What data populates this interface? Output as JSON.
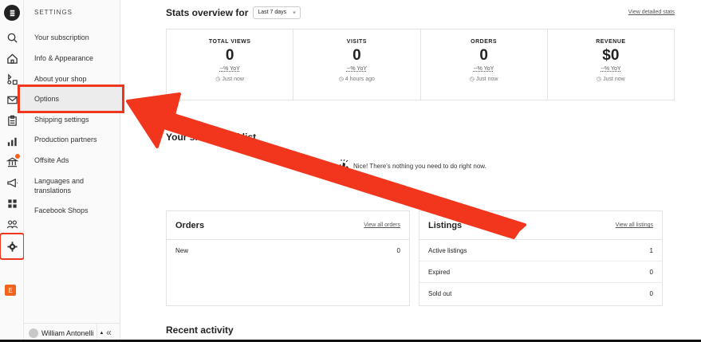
{
  "settings": {
    "title": "SETTINGS",
    "items": [
      {
        "label": "Your subscription"
      },
      {
        "label": "Info & Appearance"
      },
      {
        "label": "About your shop"
      },
      {
        "label": "Options"
      },
      {
        "label": "Shipping settings"
      },
      {
        "label": "Production partners"
      },
      {
        "label": "Offsite Ads"
      },
      {
        "label": "Languages and translations"
      },
      {
        "label": "Facebook Shops"
      }
    ],
    "active": "Options"
  },
  "user": {
    "name": "William Antonelli",
    "caret": "▲",
    "collapse": "«"
  },
  "rail": {
    "icons": [
      "logo-icon",
      "search-icon",
      "home-icon",
      "listings-icon",
      "messages-icon",
      "orders-icon",
      "stats-icon",
      "finances-icon",
      "marketing-icon",
      "integrations-icon",
      "community-icon",
      "settings-icon"
    ],
    "shop_badge": "E",
    "accent": "#f1641e",
    "highlight": "#f1361d"
  },
  "stats": {
    "heading": "Stats overview for",
    "range": "Last 7 days",
    "view_link": "View detailed stats",
    "cards": [
      {
        "label": "TOTAL VIEWS",
        "value": "0",
        "yoy": "--% YoY",
        "time": "Just now"
      },
      {
        "label": "VISITS",
        "value": "0",
        "yoy": "--% YoY",
        "time": "4 hours ago"
      },
      {
        "label": "ORDERS",
        "value": "0",
        "yoy": "--% YoY",
        "time": "Just now"
      },
      {
        "label": "REVENUE",
        "value": "$0",
        "yoy": "--% YoY",
        "time": "Just now"
      }
    ]
  },
  "checklist": {
    "heading": "Your shop checklist",
    "message": "Nice! There's nothing you need to do right now."
  },
  "orders": {
    "title": "Orders",
    "link": "View all orders",
    "rows": [
      {
        "label": "New",
        "value": "0"
      }
    ]
  },
  "listings": {
    "title": "Listings",
    "link": "View all listings",
    "rows": [
      {
        "label": "Active listings",
        "value": "1"
      },
      {
        "label": "Expired",
        "value": "0"
      },
      {
        "label": "Sold out",
        "value": "0"
      }
    ]
  },
  "recent": {
    "heading": "Recent activity"
  }
}
